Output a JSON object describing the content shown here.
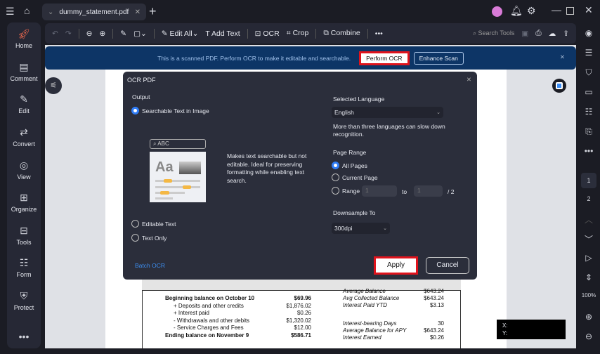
{
  "tab": {
    "title": "dummy_statement.pdf"
  },
  "sidebar": [
    {
      "label": "Home",
      "icon": "rocket-icon"
    },
    {
      "label": "Comment",
      "icon": "comment-icon"
    },
    {
      "label": "Edit",
      "icon": "edit-icon"
    },
    {
      "label": "Convert",
      "icon": "convert-icon"
    },
    {
      "label": "View",
      "icon": "eye-icon"
    },
    {
      "label": "Organize",
      "icon": "organize-icon"
    },
    {
      "label": "Tools",
      "icon": "toolbox-icon"
    },
    {
      "label": "Form",
      "icon": "form-icon"
    },
    {
      "label": "Protect",
      "icon": "shield-icon"
    }
  ],
  "toolbar": {
    "edit_all": "Edit All",
    "add_text": "Add Text",
    "ocr": "OCR",
    "crop": "Crop",
    "combine": "Combine",
    "search": "Search Tools"
  },
  "banner": {
    "message": "This is a scanned PDF. Perform OCR to make it editable and searchable.",
    "perform": "Perform OCR",
    "enhance": "Enhance Scan"
  },
  "dialog": {
    "title": "OCR PDF",
    "output_label": "Output",
    "options": [
      "Searchable Text in Image",
      "Editable Text",
      "Text Only"
    ],
    "preview_search": "ABC",
    "preview_aa": "Aa",
    "description": "Makes text searchable but not editable. Ideal for preserving formatting while enabling text search.",
    "lang_label": "Selected Language",
    "language": "English",
    "lang_note": "More than three languages can slow down recognition.",
    "range_label": "Page Range",
    "range_options": [
      "All Pages",
      "Current Page",
      "Range"
    ],
    "range_from": "1",
    "range_to_label": "to",
    "range_to": "1",
    "range_total": "/ 2",
    "downsample_label": "Downsample To",
    "downsample": "300dpi",
    "batch": "Batch OCR",
    "apply": "Apply",
    "cancel": "Cancel"
  },
  "statement": {
    "left": [
      [
        "Beginning balance on October 10",
        "$69.96"
      ],
      [
        "+ Deposits and other credits",
        "$1,876.02"
      ],
      [
        "+ Interest paid",
        "$0.26"
      ],
      [
        "- Withdrawals and other debits",
        "$1,320.02"
      ],
      [
        "- Service Charges and Fees",
        "$12.00"
      ],
      [
        "Ending balance on November 9",
        "$586.71"
      ]
    ],
    "right": [
      [
        "Average Balance",
        "$643.24"
      ],
      [
        "Avg Collected Balance",
        "$643.24"
      ],
      [
        "Interest Paid YTD",
        "$3.13"
      ],
      [
        "Interest-bearing Days",
        "30"
      ],
      [
        "Average Balance for APY",
        "$643.24"
      ],
      [
        "Interest Earned",
        "$0.26"
      ]
    ]
  },
  "coords": {
    "x": "X:",
    "y": "Y:"
  },
  "rightbar": {
    "page1": "1",
    "page2": "2",
    "zoom": "100%"
  }
}
